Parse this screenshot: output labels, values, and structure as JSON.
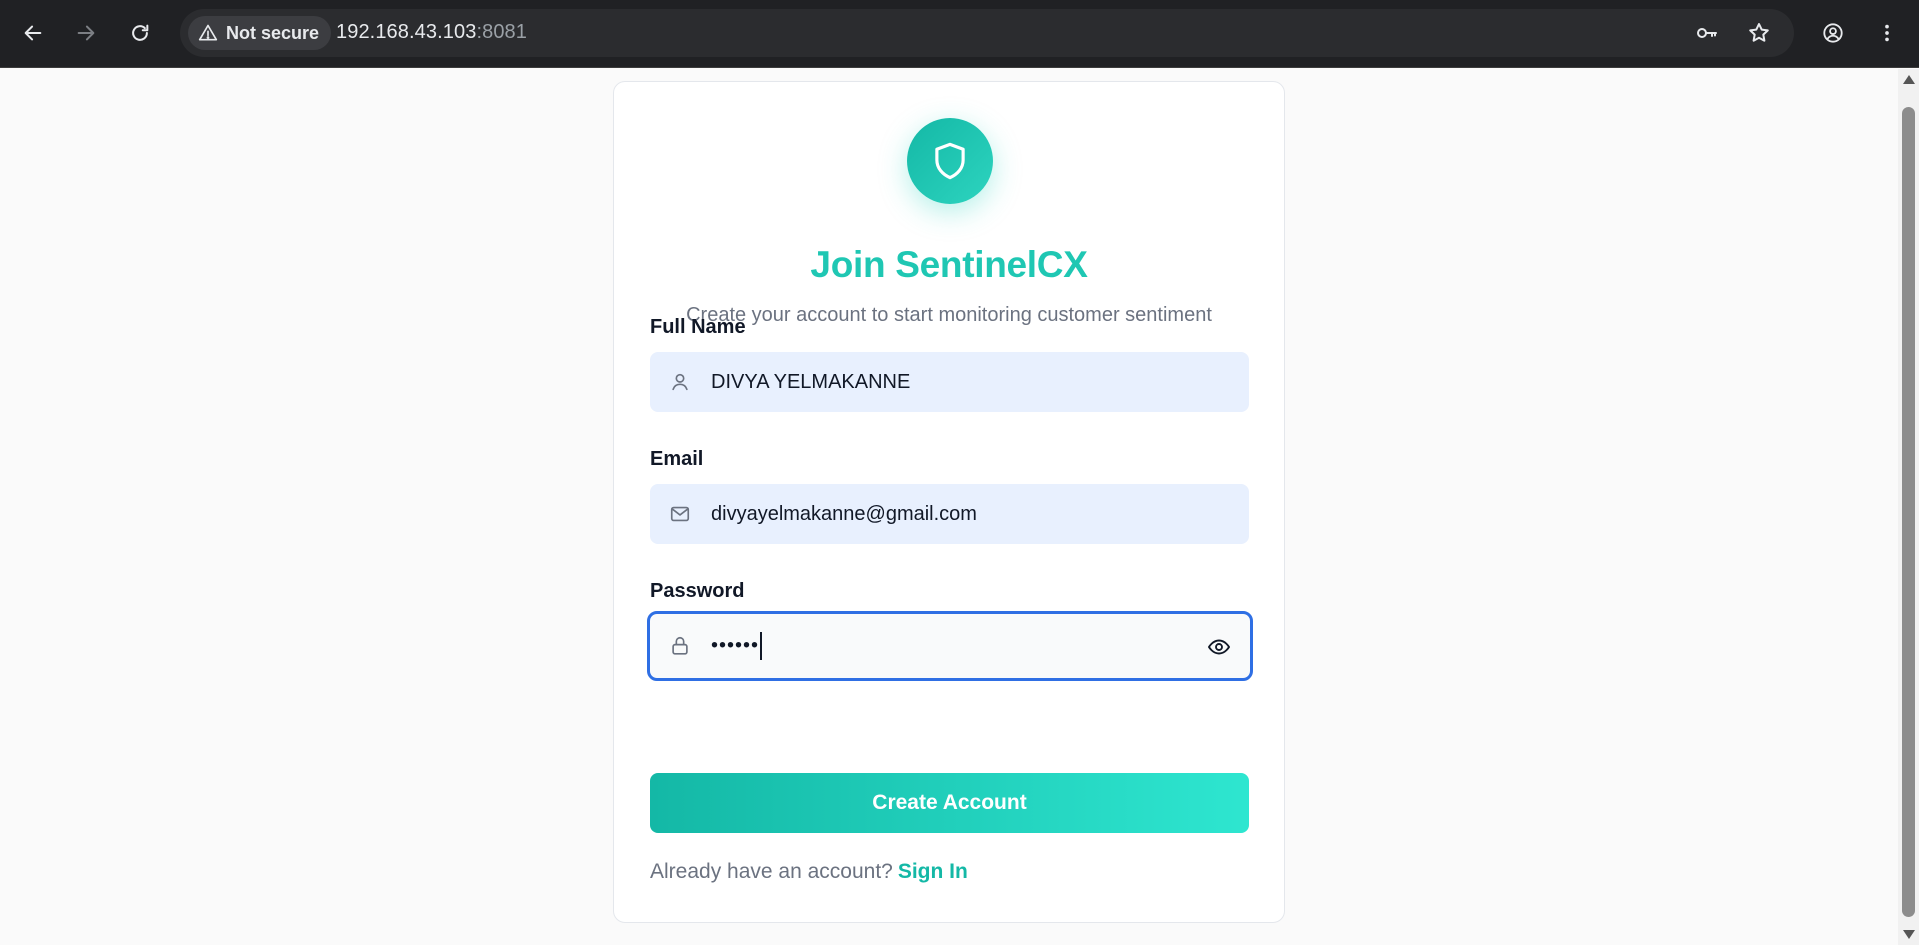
{
  "browser": {
    "security_label": "Not secure",
    "url_host": "192.168.43.103",
    "url_port": ":8081",
    "icons": [
      "back-arrow-icon",
      "forward-arrow-icon",
      "reload-icon",
      "warning-triangle-icon",
      "key-icon",
      "star-icon",
      "profile-icon",
      "kebab-menu-icon"
    ]
  },
  "signup": {
    "logo_icon": "shield-icon",
    "title": "Join SentinelCX",
    "subtitle": "Create your account to start monitoring customer sentiment",
    "full_name": {
      "label": "Full Name",
      "value": "DIVYA YELMAKANNE",
      "icon": "user-icon"
    },
    "email": {
      "label": "Email",
      "value": "divyayelmakanne@gmail.com",
      "icon": "mail-icon"
    },
    "password": {
      "label": "Password",
      "masked_value": "••••••",
      "icon": "lock-icon",
      "toggle_icon": "eye-icon"
    },
    "submit_label": "Create Account",
    "footer_prompt": "Already have an account?",
    "footer_link": "Sign In"
  },
  "colors": {
    "brand": "#1fc7b3",
    "button_gradient_start": "#14b8a6",
    "button_gradient_end": "#2ee6d0",
    "autofill_bg": "#e8f0fe",
    "focus_ring": "#2f6fe4",
    "chrome_bg": "#202124"
  }
}
